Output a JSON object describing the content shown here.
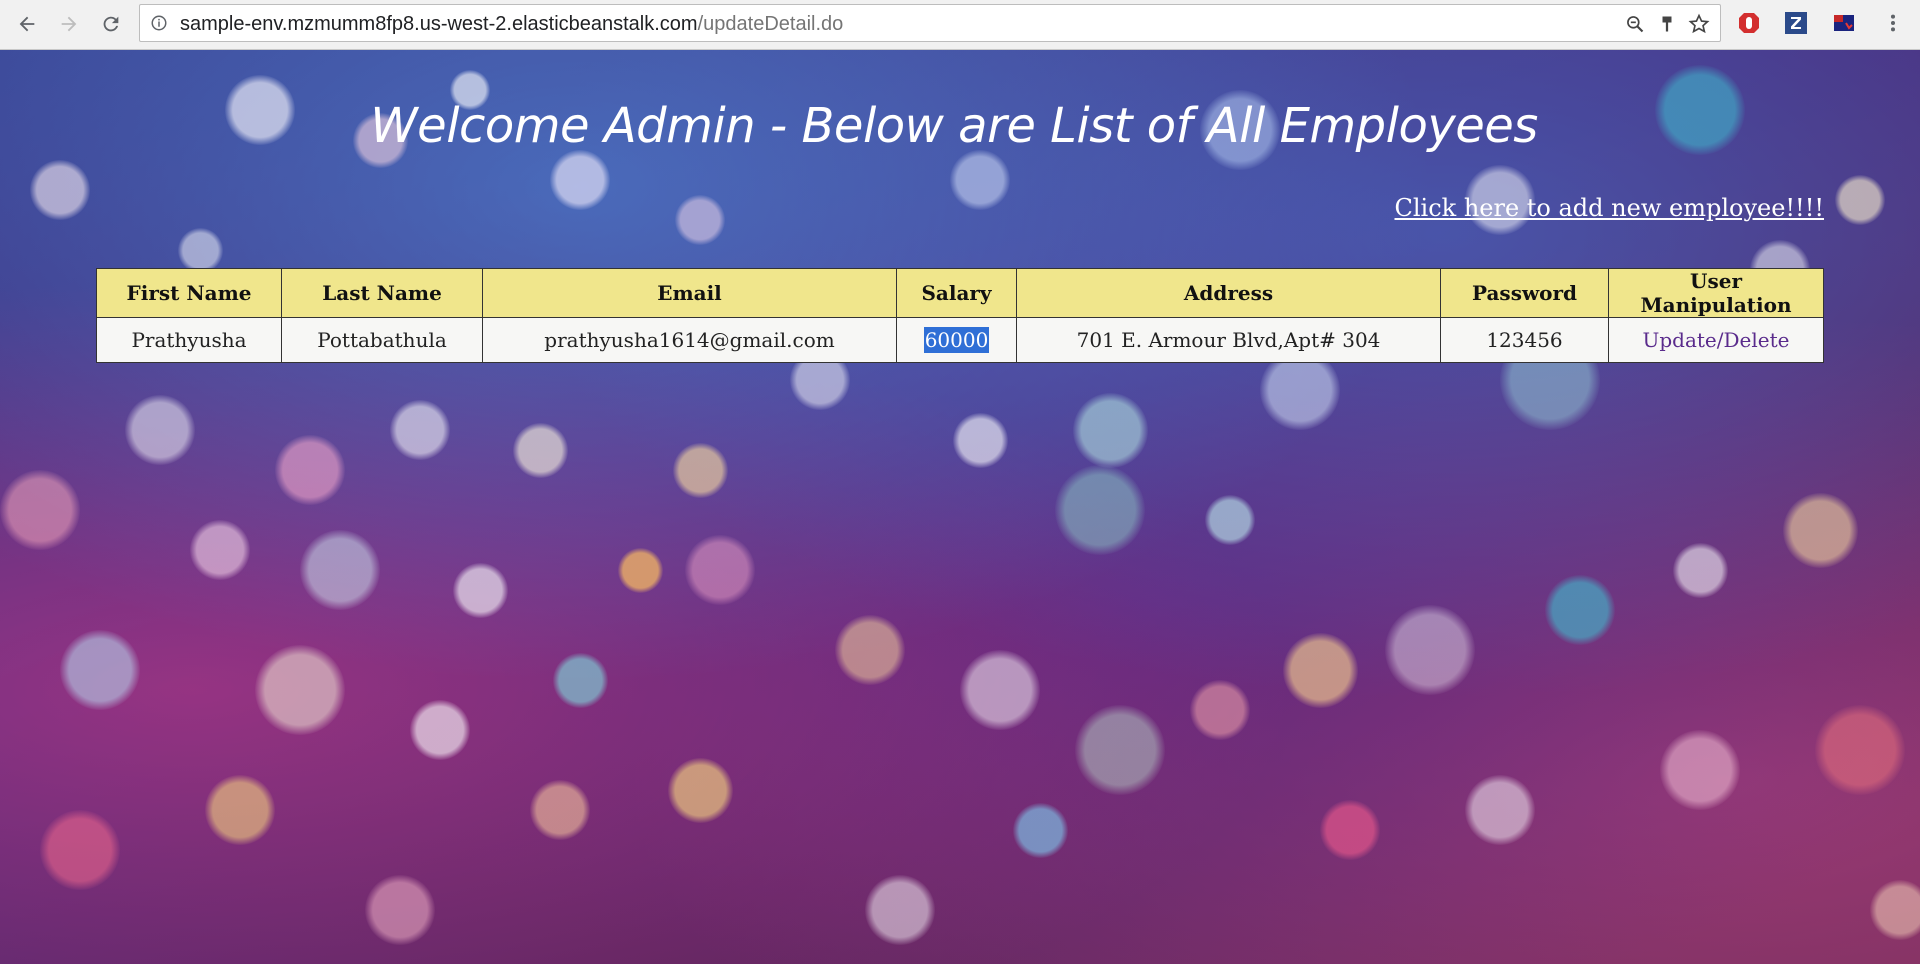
{
  "browser": {
    "url_host": "sample-env.mzmumm8fp8.us-west-2.elasticbeanstalk.com",
    "url_path": "/updateDetail.do",
    "icons": [
      "back-icon",
      "forward-icon",
      "reload-icon",
      "info-icon",
      "zoom-icon",
      "paintbrush-extension-icon",
      "star-icon",
      "adblock-icon",
      "z-extension-icon",
      "flag-extension-icon",
      "menu-icon"
    ]
  },
  "page": {
    "heading": "Welcome Admin - Below are List of All Employees",
    "add_link": "Click here to add new employee!!!!"
  },
  "table": {
    "headers": [
      "First Name",
      "Last Name",
      "Email",
      "Salary",
      "Address",
      "Password",
      "User Manipulation"
    ],
    "rows": [
      {
        "first_name": "Prathyusha",
        "last_name": "Pottabathula",
        "email": "prathyusha1614@gmail.com",
        "salary": "60000",
        "address": "701 E. Armour Blvd,Apt# 304",
        "password": "123456",
        "action": "Update/Delete"
      }
    ]
  },
  "colors": {
    "header_bg": "#f0e68c",
    "cell_bg": "#f7f7f5",
    "selection": "#2f6fd6",
    "link": "#5a2b8c"
  }
}
